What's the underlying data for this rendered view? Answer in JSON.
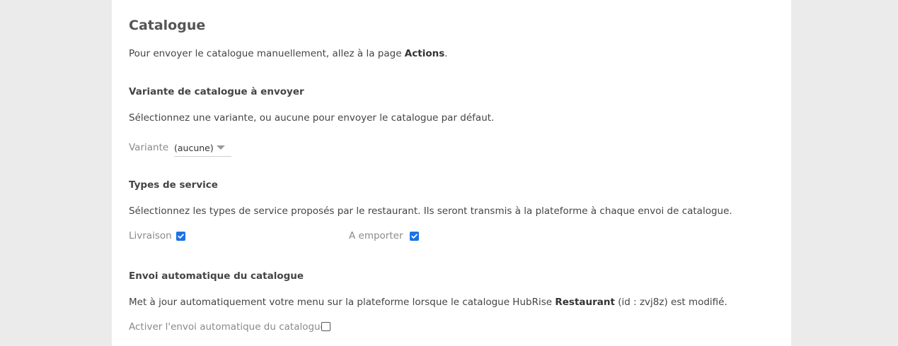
{
  "catalogue": {
    "title": "Catalogue",
    "intro_prefix": "Pour envoyer le catalogue manuellement, allez à la page ",
    "intro_link": "Actions",
    "intro_suffix": "."
  },
  "variant_section": {
    "heading": "Variante de catalogue à envoyer",
    "description": "Sélectionnez une variante, ou aucune pour envoyer le catalogue par défaut.",
    "field_label": "Variante",
    "selected_value": "(aucune)"
  },
  "service_types": {
    "heading": "Types de service",
    "description": "Sélectionnez les types de service proposés par le restaurant. Ils seront transmis à la plateforme à chaque envoi de catalogue.",
    "delivery_label": "Livraison",
    "delivery_checked": true,
    "takeaway_label": "A emporter",
    "takeaway_checked": true
  },
  "auto_send": {
    "heading": "Envoi automatique du catalogue",
    "description_prefix": "Met à jour automatiquement votre menu sur la plateforme lorsque le catalogue HubRise ",
    "catalog_name": "Restaurant",
    "description_suffix": " (id : zvj8z) est modifié.",
    "toggle_label": "Activer l'envoi automatique du catalogue",
    "toggle_checked": false
  },
  "colors": {
    "checkbox_accent": "#1a73e8",
    "page_background": "#ebebeb",
    "panel_background": "#ffffff"
  }
}
